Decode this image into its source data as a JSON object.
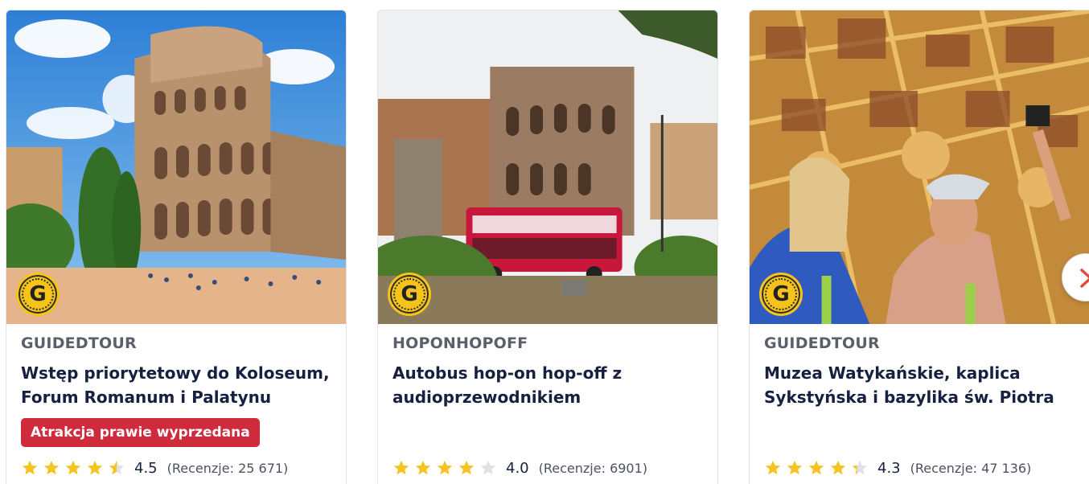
{
  "cards": [
    {
      "category": "GUIDEDTOUR",
      "title": "Wstęp priorytetowy do Koloseum, Forum Romanum i Palatynu",
      "badge_letter": "G",
      "alert": "Atrakcja prawie wyprzedana",
      "rating": 4.5,
      "rating_text": "4.5",
      "reviews": "(Recenzje: 25 671)"
    },
    {
      "category": "HOPONHOPOFF",
      "title": "Autobus hop-on hop-off z audioprzewodnikiem",
      "badge_letter": "G",
      "rating": 4.0,
      "rating_text": "4.0",
      "reviews": "(Recenzje: 6901)"
    },
    {
      "category": "GUIDEDTOUR",
      "title": "Muzea Watykańskie, kaplica Sykstyńska i bazylika św. Piotra",
      "badge_letter": "G",
      "rating": 4.3,
      "rating_text": "4.3",
      "reviews": "(Recenzje: 47 136)"
    }
  ],
  "icons": {
    "badge": "guide-badge-icon",
    "star": "star-icon",
    "next": "chevron-right-icon"
  },
  "colors": {
    "alert_bg": "#cf2b3c",
    "star_filled": "#f5c423",
    "star_empty": "#dfe1e6",
    "title": "#17213f",
    "category": "#5b5f6a",
    "next_chevron": "#e04a3c"
  }
}
